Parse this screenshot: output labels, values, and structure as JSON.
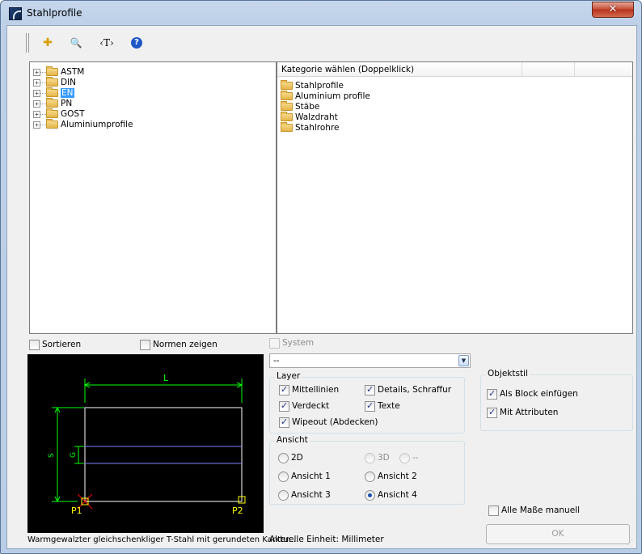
{
  "window": {
    "title": "Stahlprofile",
    "close_label": "✕"
  },
  "toolbar": {
    "add_icon": "✚",
    "find_icon": "🔍",
    "text_label": "‹T›",
    "help_label": "?"
  },
  "tree": {
    "items": [
      {
        "label": "ASTM",
        "selected": false
      },
      {
        "label": "DIN",
        "selected": false
      },
      {
        "label": "EN",
        "selected": true
      },
      {
        "label": "PN",
        "selected": false
      },
      {
        "label": "GOST",
        "selected": false
      },
      {
        "label": "Aluminiumprofile",
        "selected": false
      }
    ]
  },
  "list": {
    "header": "Kategorie wählen (Doppelklick)",
    "items": [
      "Stahlprofile",
      "Aluminium profile",
      "Stäbe",
      "Walzdraht",
      "Stahlrohre"
    ]
  },
  "options": {
    "sort_label": "Sortieren",
    "sort_checked": false,
    "norms_label": "Normen zeigen",
    "norms_checked": false,
    "system_label": "System",
    "system_checked": false,
    "combo_value": "--"
  },
  "preview": {
    "dim_L": "L",
    "dim_S": "S",
    "dim_G": "G",
    "p1": "P1",
    "p2": "P2",
    "colors": {
      "background": "#000000",
      "outline": "#ffffff",
      "dimension": "#00ff00",
      "hidden": "#8080ff",
      "point": "#ffff00",
      "marker": "#ff0000"
    }
  },
  "description": "Warmgewalzter gleichschenkliger T-Stahl mit gerundeten Kanten…",
  "layer": {
    "title": "Layer",
    "mittellinien": "Mittellinien",
    "details": "Details, Schraffur",
    "verdeckt": "Verdeckt",
    "texte": "Texte",
    "wipeout": "Wipeout (Abdecken)"
  },
  "objektstil": {
    "title": "Objektstil",
    "block": "Als Block einfügen",
    "attribute": "Mit Attributen"
  },
  "ansicht": {
    "title": "Ansicht",
    "options": [
      "2D",
      "3D",
      "--",
      "Ansicht 1",
      "Ansicht 2",
      "Ansicht 3",
      "Ansicht 4"
    ],
    "selected": "Ansicht 4"
  },
  "alle_masse": {
    "label": "Alle Maße manuell",
    "checked": false
  },
  "unit_text": "Aktuelle Einheit: Millimeter",
  "ok_label": "OK"
}
